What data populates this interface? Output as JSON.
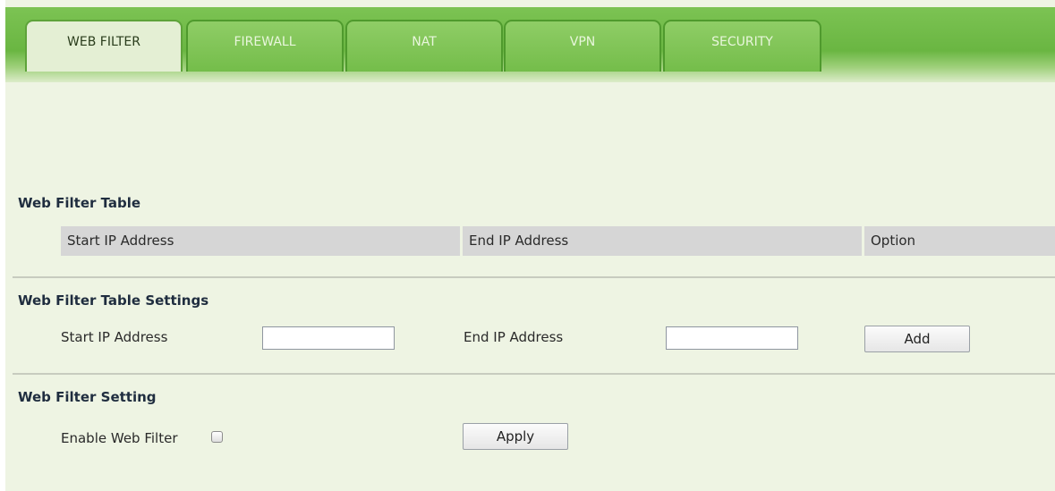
{
  "tabs": [
    {
      "label": "WEB FILTER",
      "active": true
    },
    {
      "label": "FIREWALL",
      "active": false
    },
    {
      "label": "NAT",
      "active": false
    },
    {
      "label": "VPN",
      "active": false
    },
    {
      "label": "SECURITY",
      "active": false
    }
  ],
  "web_filter_table": {
    "title": "Web Filter Table",
    "columns": [
      "Start IP Address",
      "End IP Address",
      "Option"
    ],
    "rows": []
  },
  "table_settings": {
    "title": "Web Filter Table Settings",
    "start_label": "Start IP Address",
    "start_value": "",
    "end_label": "End IP Address",
    "end_value": "",
    "add_label": "Add"
  },
  "filter_setting": {
    "title": "Web Filter Setting",
    "enable_label": "Enable Web Filter",
    "enabled": false,
    "apply_label": "Apply"
  },
  "colors": {
    "tabbar_green": "#6ab642",
    "active_tab": "#e4efd4",
    "page_background": "#eef4e3",
    "table_header": "#d6d6d6"
  }
}
